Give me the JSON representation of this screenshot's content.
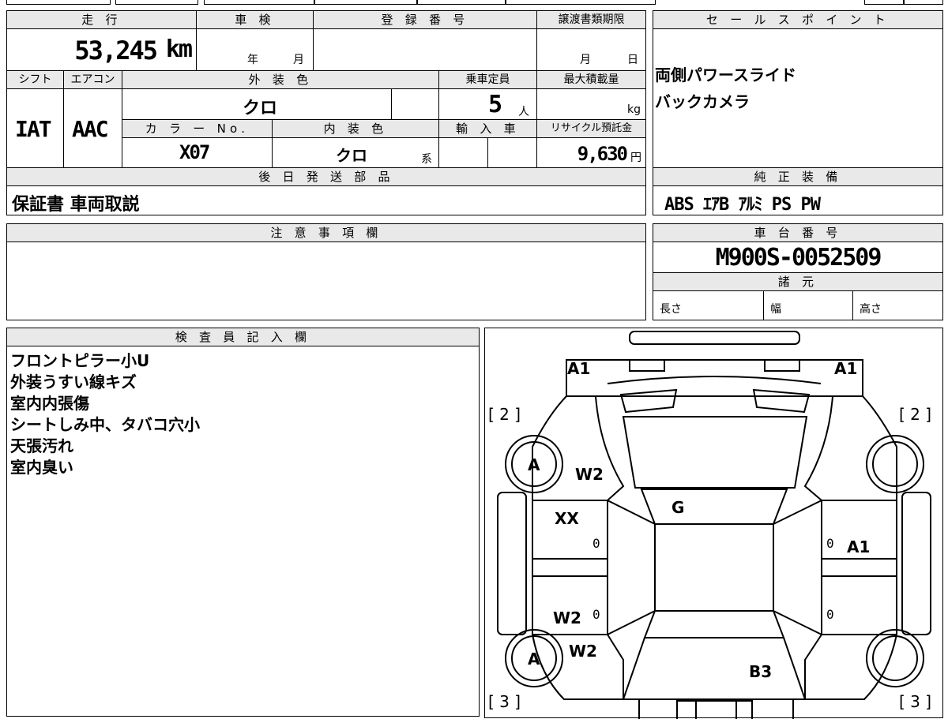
{
  "vehicle_info": {
    "mileage_label": "走 行",
    "mileage_value": "53,245",
    "mileage_unit": "km",
    "shaken_label": "車 検",
    "shaken_year": "年",
    "shaken_month": "月",
    "reg_label": "登 録 番 号",
    "transfer_label": "譲渡書類期限",
    "transfer_month": "月",
    "transfer_day": "日",
    "shift_label": "シフト",
    "shift_value": "IAT",
    "aircon_label": "エアコン",
    "aircon_value": "AAC",
    "exterior_label": "外 装 色",
    "exterior_value": "クロ",
    "capacity_label": "乗車定員",
    "capacity_value": "5",
    "capacity_unit": "人",
    "maxload_label": "最大積載量",
    "maxload_unit": "kg",
    "colorno_label": "カ ラ ー No.",
    "colorno_value": "X07",
    "interior_label": "内 装 色",
    "interior_value": "クロ",
    "interior_suffix": "系",
    "import_label": "輸 入 車",
    "recycle_label": "リサイクル預託金",
    "recycle_value": "9,630",
    "recycle_unit": "円",
    "later_label": "後 日 発 送 部 品",
    "later_value": "保証書 車両取説"
  },
  "sales_points": {
    "label": "セ ー ル ス ポ イ ン ト",
    "lines": [
      "両側パワースライド",
      "バックカメラ"
    ]
  },
  "equipment": {
    "label": "純 正 装 備",
    "value": "ABS ｴｱB ｱﾙﾐ PS PW"
  },
  "notes": {
    "label": "注 意 事 項 欄"
  },
  "chassis": {
    "label": "車 台 番 号",
    "value": "M900S-0052509",
    "specs_label": "諸 元",
    "length_label": "長さ",
    "width_label": "幅",
    "height_label": "高さ"
  },
  "inspector": {
    "label": "検 査 員 記 入 欄",
    "lines": [
      "フロントピラー小U",
      "外装うすい線キズ",
      "室内内張傷",
      "シートしみ中、タバコ穴小",
      "天張汚れ",
      "室内臭い"
    ]
  },
  "diagram": {
    "marks": {
      "front_left": "A1",
      "front_right": "A1",
      "bracket_fl": "[ 2 ]",
      "bracket_fr": "[ 2 ]",
      "bracket_rl": "[ 3 ]",
      "bracket_rr": "[ 3 ]",
      "wheel_fl": "A",
      "wheel_rl": "A",
      "w2_front": "W2",
      "g": "G",
      "xx": "XX",
      "zero_1": "0",
      "zero_2": "0",
      "zero_3": "0",
      "zero_4": "0",
      "a1_right_door": "A1",
      "w2_rear_door": "W2",
      "w2_rear": "W2",
      "b3": "B3"
    }
  }
}
